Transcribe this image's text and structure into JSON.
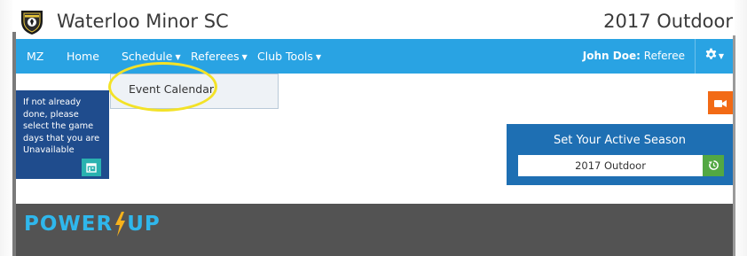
{
  "header": {
    "club_name": "Waterloo Minor SC",
    "season": "2017 Outdoor"
  },
  "nav": {
    "items": [
      {
        "label": "MZ"
      },
      {
        "label": "Home"
      },
      {
        "label": "Schedule"
      },
      {
        "label": "Referees"
      },
      {
        "label": "Club Tools"
      }
    ],
    "user_name": "John Doe",
    "user_role": "Referee"
  },
  "dropdown": {
    "items": [
      {
        "label": "Event Calendar"
      }
    ]
  },
  "notice": {
    "text": "If not already done, please select the game days that you are Unavailable"
  },
  "season_panel": {
    "title": "Set Your Active Season",
    "selected": "2017 Outdoor"
  },
  "banner": {
    "power_text": "POWER",
    "up_text": "UP"
  },
  "colors": {
    "navbar": "#29a3e3",
    "notice": "#1f4c8d",
    "season_panel": "#1e6fb3",
    "video_button": "#f26a15",
    "refresh_button": "#53a843",
    "banner": "#535353",
    "highlight": "#f3e227"
  },
  "icons": {
    "logo": "club-shield-icon",
    "settings": "gear-icon",
    "notice_action": "calendar-icon",
    "video": "video-camera-icon",
    "refresh": "refresh-icon",
    "power": "lightning-bolt-icon"
  }
}
